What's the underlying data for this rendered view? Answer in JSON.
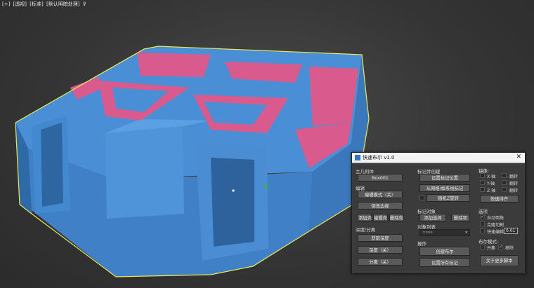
{
  "viewport": {
    "label_plus": "[+]",
    "label_view": "[透视]",
    "label_mode": "[标准]",
    "label_shading": "[默认明暗处理]",
    "filter_icon": "filter-icon"
  },
  "colors": {
    "mesh_blue": "#4a8fd6",
    "mesh_pink": "#d95a8d",
    "selection_outline": "#e8e85a"
  },
  "panel": {
    "title": "快速布尔 v1.0",
    "close": "✕",
    "left": {
      "main_mesh_label": "主几何体",
      "main_mesh_button": "Box001",
      "edit_label": "编辑",
      "edit_mode_button": "编辑模式（关）",
      "chamfer_button": "倒角边缘",
      "add_shell_button": "添加壳",
      "edit_shell_button": "编辑壳",
      "remove_shell_button": "删除壳",
      "depth_label": "深度/分离",
      "get_depth_button": "获取深度",
      "depth_off_button": "深度（关）",
      "separate_off_button": "分离（关）"
    },
    "mid": {
      "mark_label": "标记并创建",
      "set_mark_button": "设置标记位置",
      "from_grid_button": "从网格/样条线标记",
      "random_z_button": "随机Z旋转",
      "mark_objects_label": "标记对象",
      "add_selected_button": "添加选择",
      "remove_item_button": "删除项",
      "object_list_label": "对象列表",
      "object_list_value": "none",
      "operation_label": "操作",
      "create_bool_button": "创建布尔",
      "reset_marks_button": "设置所有标记"
    },
    "right": {
      "mirror_label": "镜像:",
      "x_axis": "X-轴",
      "y_axis": "Y-轴",
      "z_axis": "Z-轴",
      "flip": "翻转",
      "quick_align_button": "快速排齐",
      "options_label": "选项",
      "auto_chamfer": "自动倒角",
      "clone_cut": "克隆切割",
      "quick_edit": "快速编辑",
      "quick_edit_value": "0.01",
      "bool_mode_label": "布尔模式:",
      "union": "并集",
      "move": "移除",
      "about_button": "关于更多脚本"
    }
  }
}
